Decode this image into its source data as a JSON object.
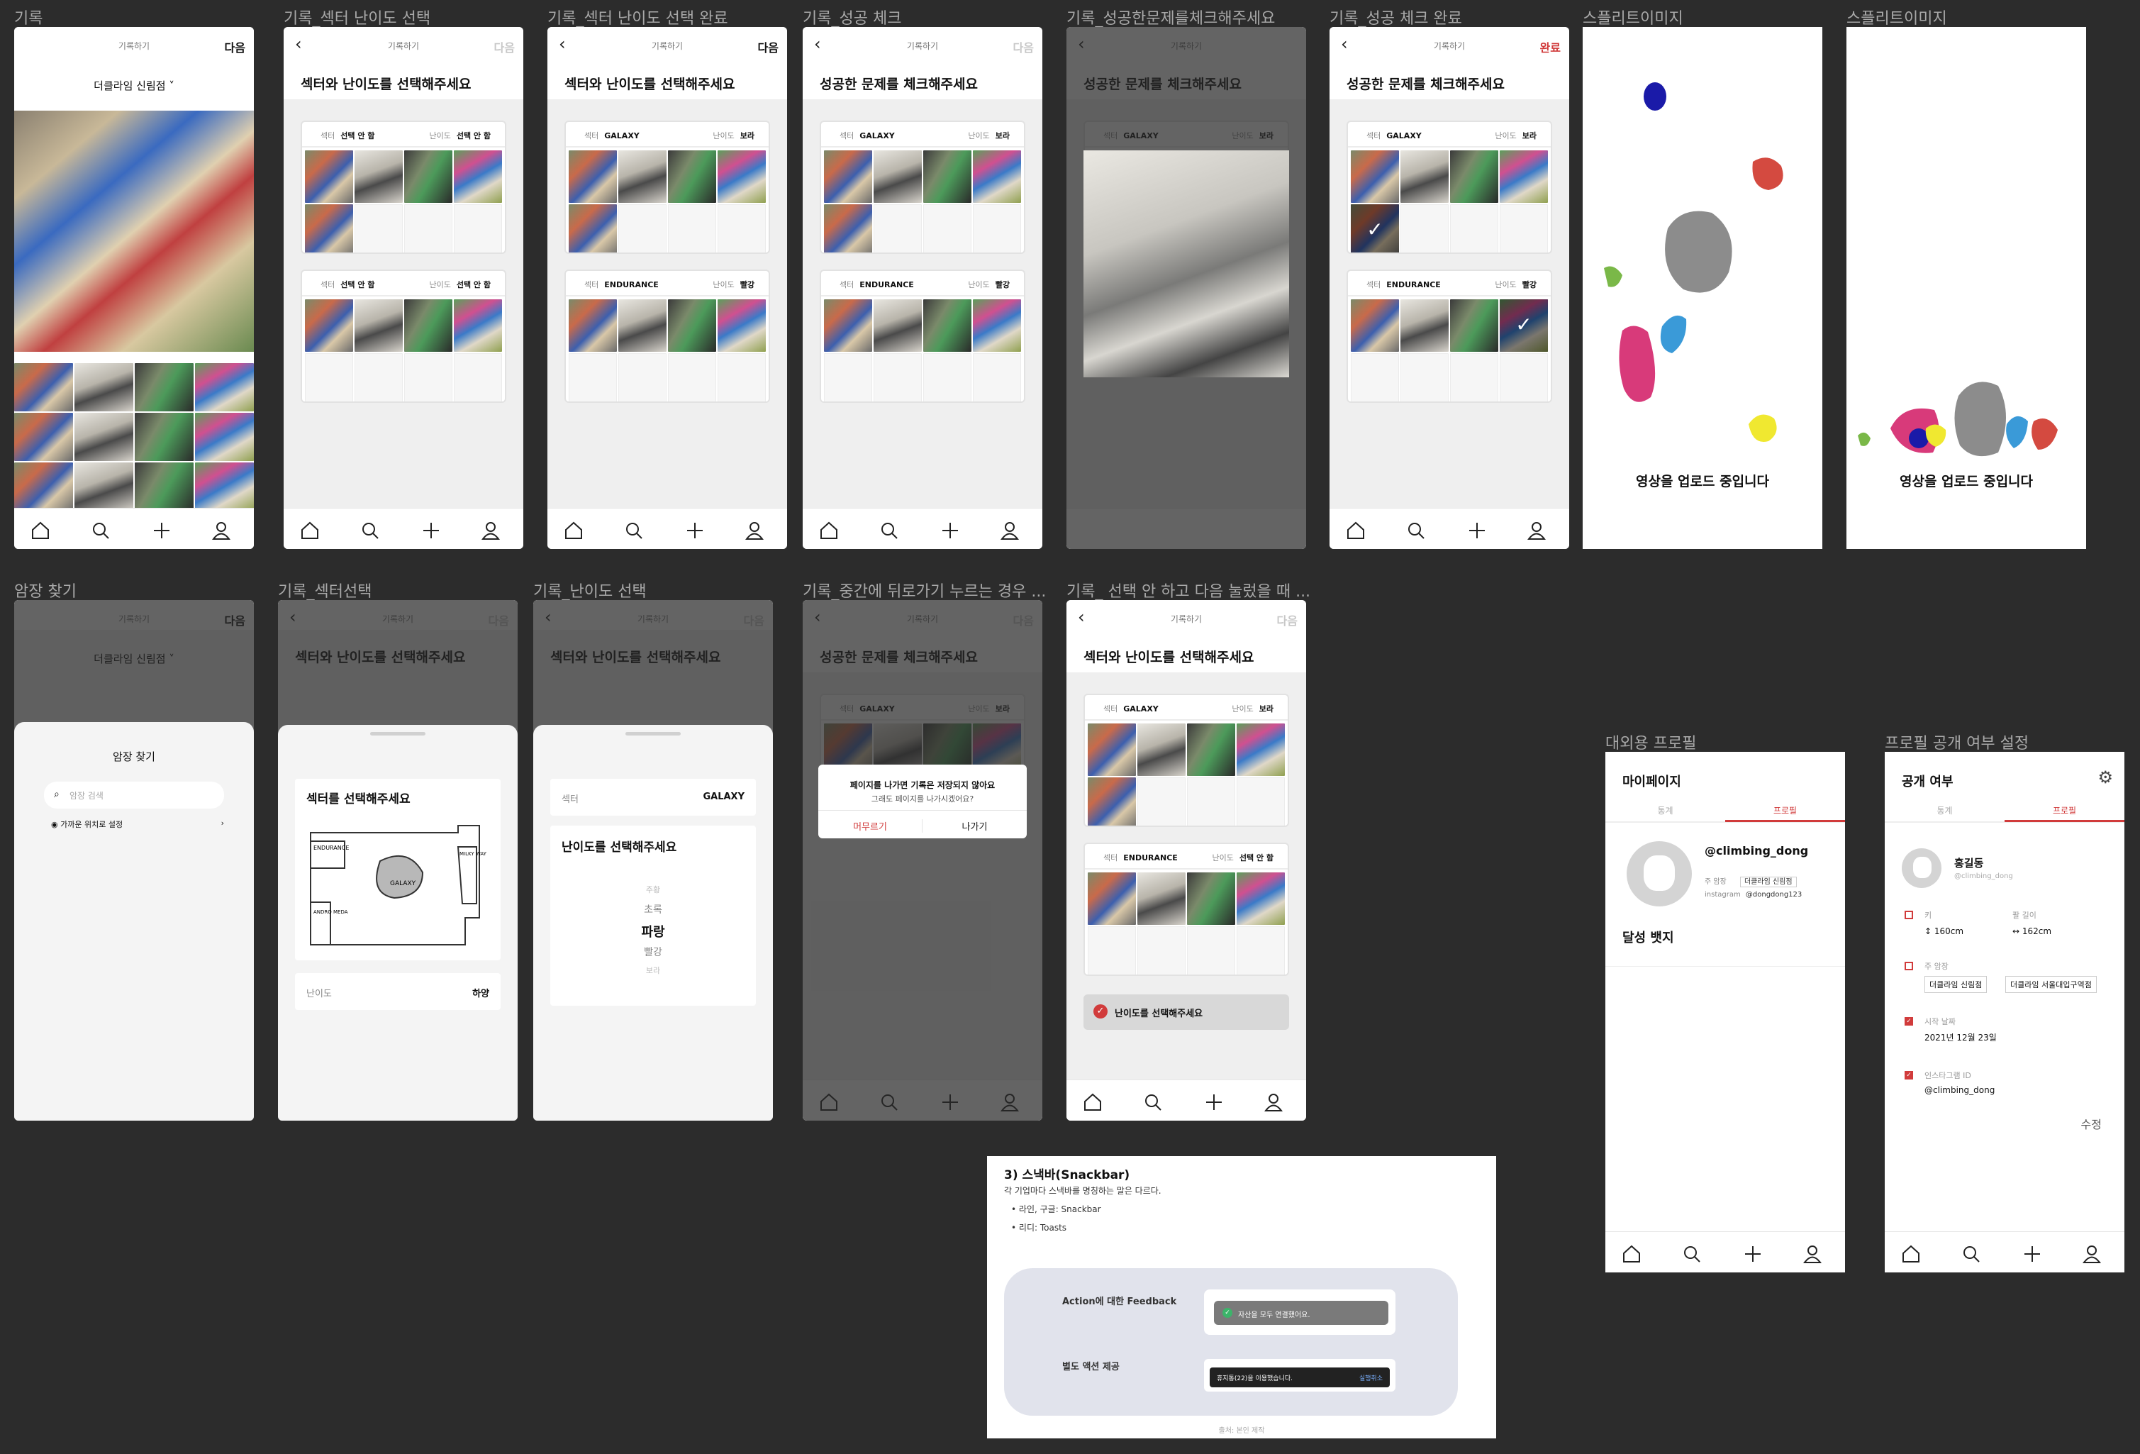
{
  "labels": {
    "f1": "기록",
    "f2": "기록_섹터 난이도 선택",
    "f3": "기록_섹터 난이도 선택 완료",
    "f4": "기록_성공 체크",
    "f5": "기록_성공한문제를체크해주세요",
    "f6": "기록_성공 체크 완료",
    "f7": "스플리트이미지",
    "f8": "스플리트이미지",
    "r1": "암장 찾기",
    "r2": "기록_섹터선택",
    "r3": "기록_난이도 선택",
    "r4": "기록_중간에 뒤로가기 누르는 경우 ...",
    "r5": "기록_ 선택 안 하고 다음 눌렀을 때 ...",
    "p1": "대외용 프로필",
    "p2": "프로필 공개 여부 설정"
  },
  "header": {
    "title": "기록하기",
    "next": "다음",
    "done": "완료"
  },
  "gym": {
    "name": "더클라임 신림점"
  },
  "prompts": {
    "sector_grade": "섹터와 난이도를 선택해주세요",
    "success": "성공한 문제를 체크해주세요"
  },
  "card": {
    "sector": "섹터",
    "grade": "난이도",
    "none": "선택 안 함",
    "galaxy": "GALAXY",
    "endurance": "ENDURANCE",
    "purple": "보라",
    "red": "빨강"
  },
  "splash": {
    "text": "영상을 업로드 중입니다"
  },
  "gymsearch": {
    "title": "암장 찾기",
    "placeholder": "암장 검색",
    "nearby": "가까운 위치로 설정"
  },
  "sectorpick": {
    "title": "섹터를 선택해주세요",
    "galaxy": "GALAXY",
    "endurance": "ENDURANCE",
    "milky": "MILKY WAY",
    "andro": "ANDRO MEDA",
    "grade": "난이도",
    "grade_val": "하양"
  },
  "gradepick": {
    "sector": "섹터",
    "sector_val": "GALAXY",
    "title": "난이도를 선택해주세요",
    "options": [
      "주황",
      "초록",
      "파랑",
      "빨강",
      "보라"
    ]
  },
  "dialog": {
    "msg1": "페이지를 나가면 기록은 저장되지 않아요",
    "msg2": "그래도 페이지를 나가시겠어요?",
    "stay": "머무르기",
    "leave": "나가기"
  },
  "warn": {
    "text": "난이도를 선택해주세요"
  },
  "profile": {
    "title": "마이페이지",
    "tab1": "통계",
    "tab2": "프로필",
    "handle": "@climbing_dong",
    "gym_lbl": "주 암장",
    "gym_val": "더클라임 신림점",
    "insta_lbl": "instagram",
    "insta_val": "@dongdong123",
    "badge": "달성 뱃지"
  },
  "privacy": {
    "title": "공개 여부",
    "tab1": "통계",
    "tab2": "프로필",
    "name": "홍길동",
    "handle": "@climbing_dong",
    "height_lbl": "키",
    "height": "160cm",
    "arm_lbl": "팔 길이",
    "arm": "162cm",
    "gyms_lbl": "주 암장",
    "gym1": "더클라임 신림점",
    "gym2": "더클라임 서울대입구역점",
    "start_lbl": "시작 날짜",
    "start": "2021년 12월 23일",
    "insta_lbl": "인스타그램 ID",
    "insta": "@climbing_dong",
    "edit": "수정"
  },
  "note": {
    "title": "3) 스낵바(Snackbar)",
    "desc": "각 기업마다 스낵바를 명칭하는 말은 다르다.",
    "b1": "라인, 구글: Snackbar",
    "b2": "리디: Toasts",
    "row1": "Action에 대한 Feedback",
    "row2": "별도 액션 제공",
    "toast1": "자산을 모두 연결했어요.",
    "toast2": "휴지통(22)을 이용했습니다.",
    "undo": "실행취소",
    "credit": "출처: 본인 제작"
  },
  "colors": {
    "accent": "#d13b3b",
    "bg": "#2c2c2c"
  }
}
